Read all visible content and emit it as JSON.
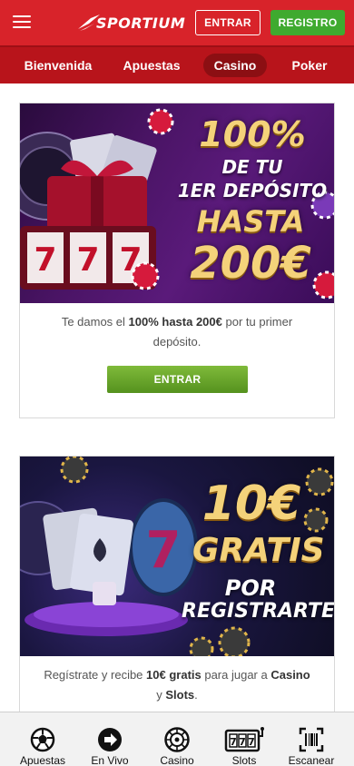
{
  "header": {
    "brand": "SPORTIUM",
    "login_label": "ENTRAR",
    "register_label": "REGISTRO"
  },
  "nav": {
    "items": [
      {
        "label": "Bienvenida"
      },
      {
        "label": "Apuestas"
      },
      {
        "label": "Casino"
      },
      {
        "label": "Poker"
      }
    ],
    "active": "Casino"
  },
  "promos": [
    {
      "banner_lines": [
        "100%",
        "DE TU",
        "1ER DEPÓSITO",
        "HASTA",
        "200€"
      ],
      "desc_pre": "Te damos el ",
      "desc_bold": "100% hasta 200€",
      "desc_post": " por tu primer depósito.",
      "button_label": "ENTRAR"
    },
    {
      "banner_lines": [
        "10€",
        "GRATIS",
        "POR",
        "REGISTRARTE"
      ],
      "desc_pre": "Regístrate y recibe ",
      "desc_bold": "10€ gratis",
      "desc_mid": " para jugar a ",
      "desc_bold2": "Casino",
      "desc_mid2": " y ",
      "desc_bold3": "Slots",
      "desc_post": "."
    }
  ],
  "tabbar": {
    "items": [
      {
        "label": "Apuestas",
        "icon": "soccer-ball-icon"
      },
      {
        "label": "En Vivo",
        "icon": "play-arrow-icon"
      },
      {
        "label": "Casino",
        "icon": "roulette-icon"
      },
      {
        "label": "Slots",
        "icon": "slot-machine-icon"
      },
      {
        "label": "Escanear",
        "icon": "barcode-scan-icon"
      }
    ]
  },
  "colors": {
    "header_red": "#d8232a",
    "nav_red": "#b8141b",
    "register_green": "#3faa2f",
    "cta_green": "#6aa82c",
    "banner_gold": "#f4d27a"
  }
}
